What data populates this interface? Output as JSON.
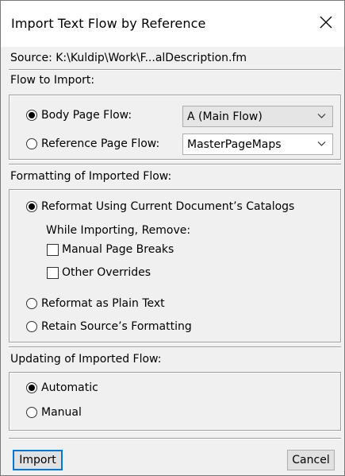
{
  "dialog": {
    "title": "Import Text Flow by Reference",
    "source_label": "Source:  K:\\Kuldip\\Work\\F...alDescription.fm"
  },
  "flow_to_import": {
    "heading": "Flow to Import:",
    "body_page_flow_label": "Body Page Flow:",
    "body_page_flow_value": "A (Main Flow)",
    "reference_page_flow_label": "Reference Page Flow:",
    "reference_page_flow_value": "MasterPageMaps",
    "selected": "body_page_flow"
  },
  "formatting": {
    "heading": "Formatting of Imported Flow:",
    "reformat_catalogs_label": "Reformat Using Current Document’s Catalogs",
    "while_importing_label": "While Importing, Remove:",
    "manual_page_breaks_label": "Manual Page Breaks",
    "other_overrides_label": "Other Overrides",
    "plain_text_label": "Reformat as Plain Text",
    "retain_source_label": "Retain Source’s Formatting",
    "selected": "reformat_catalogs",
    "manual_page_breaks_checked": false,
    "other_overrides_checked": false
  },
  "updating": {
    "heading": "Updating of Imported Flow:",
    "automatic_label": "Automatic",
    "manual_label": "Manual",
    "selected": "automatic"
  },
  "buttons": {
    "import_label": "Import",
    "cancel_label": "Cancel"
  },
  "icons": {
    "close": "close-icon",
    "dropdown": "chevron-down-icon"
  },
  "colors": {
    "default_button_border": "#0078d7",
    "dialog_background": "#f0f0f0",
    "titlebar_background": "#ffffff"
  }
}
